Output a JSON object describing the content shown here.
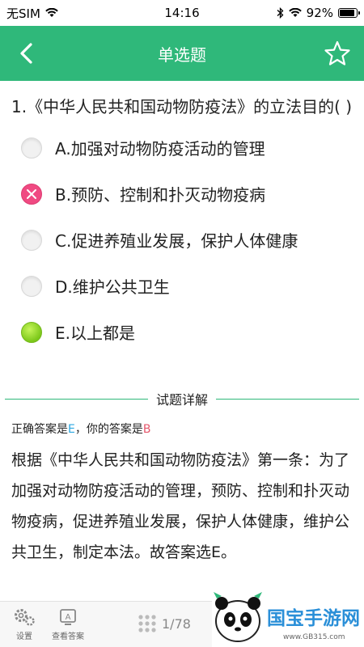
{
  "status": {
    "carrier": "无SIM",
    "time": "14:16",
    "battery": "92%"
  },
  "nav": {
    "title": "单选题"
  },
  "question": {
    "text": "1.《中华人民共和国动物防疫法》的立法目的( )"
  },
  "options": [
    {
      "label": "A.加强对动物防疫活动的管理",
      "state": "empty"
    },
    {
      "label": "B.预防、控制和扑灭动物疫病",
      "state": "wrong"
    },
    {
      "label": "C.促进养殖业发展，保护人体健康",
      "state": "empty"
    },
    {
      "label": "D.维护公共卫生",
      "state": "empty"
    },
    {
      "label": "E.以上都是",
      "state": "correct"
    }
  ],
  "detail": {
    "title": "试题详解",
    "correct_prefix": "正确答案是",
    "correct_value": "E",
    "mine_prefix": "，你的答案是",
    "mine_value": "B",
    "explanation": "根据《中华人民共和国动物防疫法》第一条：为了加强对动物防疫活动的管理，预防、控制和扑灭动物疫病，促进养殖业发展，保护人体健康，维护公共卫生，制定本法。故答案选E。"
  },
  "toolbar": {
    "settings_label": "设置",
    "view_answer_label": "查看答案",
    "page": "1/78"
  },
  "watermark": {
    "brand": "国宝手游网",
    "url": "www.GB315.com"
  },
  "colors": {
    "accent": "#2fb87a",
    "correct": "#2aa7e0",
    "wrong": "#e5566a"
  }
}
